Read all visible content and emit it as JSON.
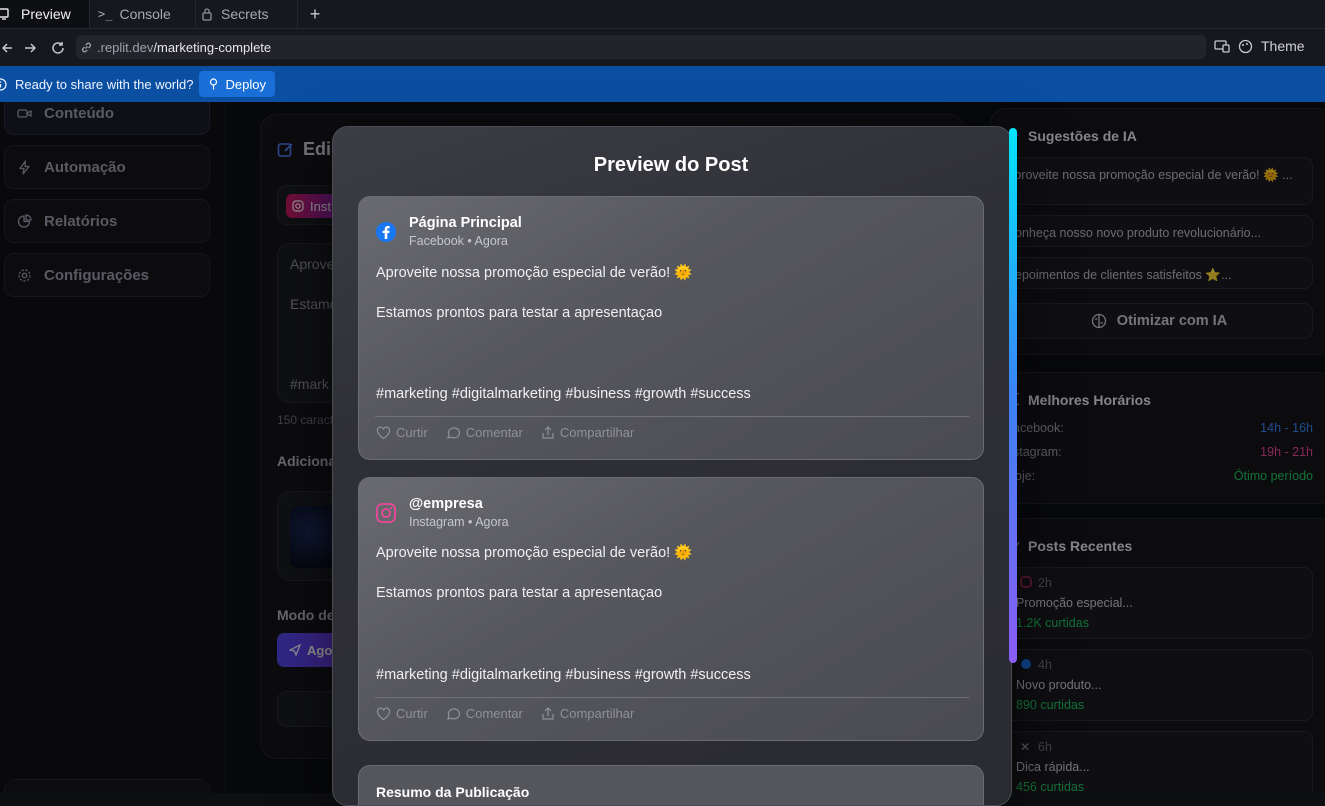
{
  "browser": {
    "tabs": [
      {
        "label": "Preview",
        "icon": "monitor-icon"
      },
      {
        "label": "Console",
        "icon": "terminal-icon"
      },
      {
        "label": "Secrets",
        "icon": "lock-icon"
      }
    ],
    "new_tab": "+",
    "url_host": ".replit.dev",
    "url_path": "/marketing-complete",
    "theme_label": "Theme",
    "banner_text": "Ready to share with the world?",
    "deploy_label": "Deploy"
  },
  "sidebar": {
    "items": [
      {
        "label": "Conteúdo",
        "icon": "video-icon"
      },
      {
        "label": "Automação",
        "icon": "lightning-icon"
      },
      {
        "label": "Relatórios",
        "icon": "pie-chart-icon"
      },
      {
        "label": "Configurações",
        "icon": "gear-icon"
      }
    ]
  },
  "editor": {
    "title": "Edi",
    "platform_chip": "Inst",
    "text_line1": "Aprove",
    "text_line2": "Estamo",
    "hashtag_stub": "#mark",
    "char_count": "150 caract",
    "add_label": "Adiciona",
    "mode_label": "Modo de",
    "now_button": "Agor"
  },
  "right": {
    "suggestions_title": "Sugestões de IA",
    "suggestions": [
      "Aproveite nossa promoção especial de verão! 🌞 ...",
      "Conheça nosso novo produto revolucionário...",
      "Depoimentos de clientes satisfeitos ⭐..."
    ],
    "optimize_label": "Otimizar com IA",
    "hours_title": "Melhores Horários",
    "hours": [
      {
        "label": "acebook:",
        "value": "14h - 16h",
        "color": "#3b82f6"
      },
      {
        "label": "stagram:",
        "value": "19h - 21h",
        "color": "#ec4899"
      },
      {
        "label": "oje:",
        "value": "Ótimo período",
        "color": "#22c55e"
      }
    ],
    "recent_title": "Posts Recentes",
    "recent": [
      {
        "time": "2h",
        "title": "Promoção especial...",
        "likes": "1.2K curtidas"
      },
      {
        "time": "4h",
        "title": "Novo produto...",
        "likes": "890 curtidas"
      },
      {
        "time": "6h",
        "title": "Dica rápida...",
        "likes": "456 curtidas"
      }
    ]
  },
  "modal": {
    "title": "Preview do Post",
    "posts": [
      {
        "platform": "facebook",
        "name": "Página Principal",
        "meta": "Facebook • Agora",
        "line1": "Aproveite nossa promoção especial de verão! 🌞",
        "line2": "Estamos prontos para testar a apresentaçao",
        "hashtags": "#marketing #digitalmarketing #business #growth #success",
        "actions": [
          "Curtir",
          "Comentar",
          "Compartilhar"
        ]
      },
      {
        "platform": "instagram",
        "name": "@empresa",
        "meta": "Instagram • Agora",
        "line1": "Aproveite nossa promoção especial de verão! 🌞",
        "line2": "Estamos prontos para testar a apresentaçao",
        "hashtags": "#marketing #digitalmarketing #business #growth #success",
        "actions": [
          "Curtir",
          "Comentar",
          "Compartilhar"
        ]
      }
    ],
    "summary_title": "Resumo da Publicação"
  },
  "colors": {
    "banner": "#0b4fa3",
    "facebook": "#1877f2",
    "instagram": "#e1306c",
    "scroll_top": "#00e5ff",
    "scroll_bottom": "#8b5cf6"
  }
}
